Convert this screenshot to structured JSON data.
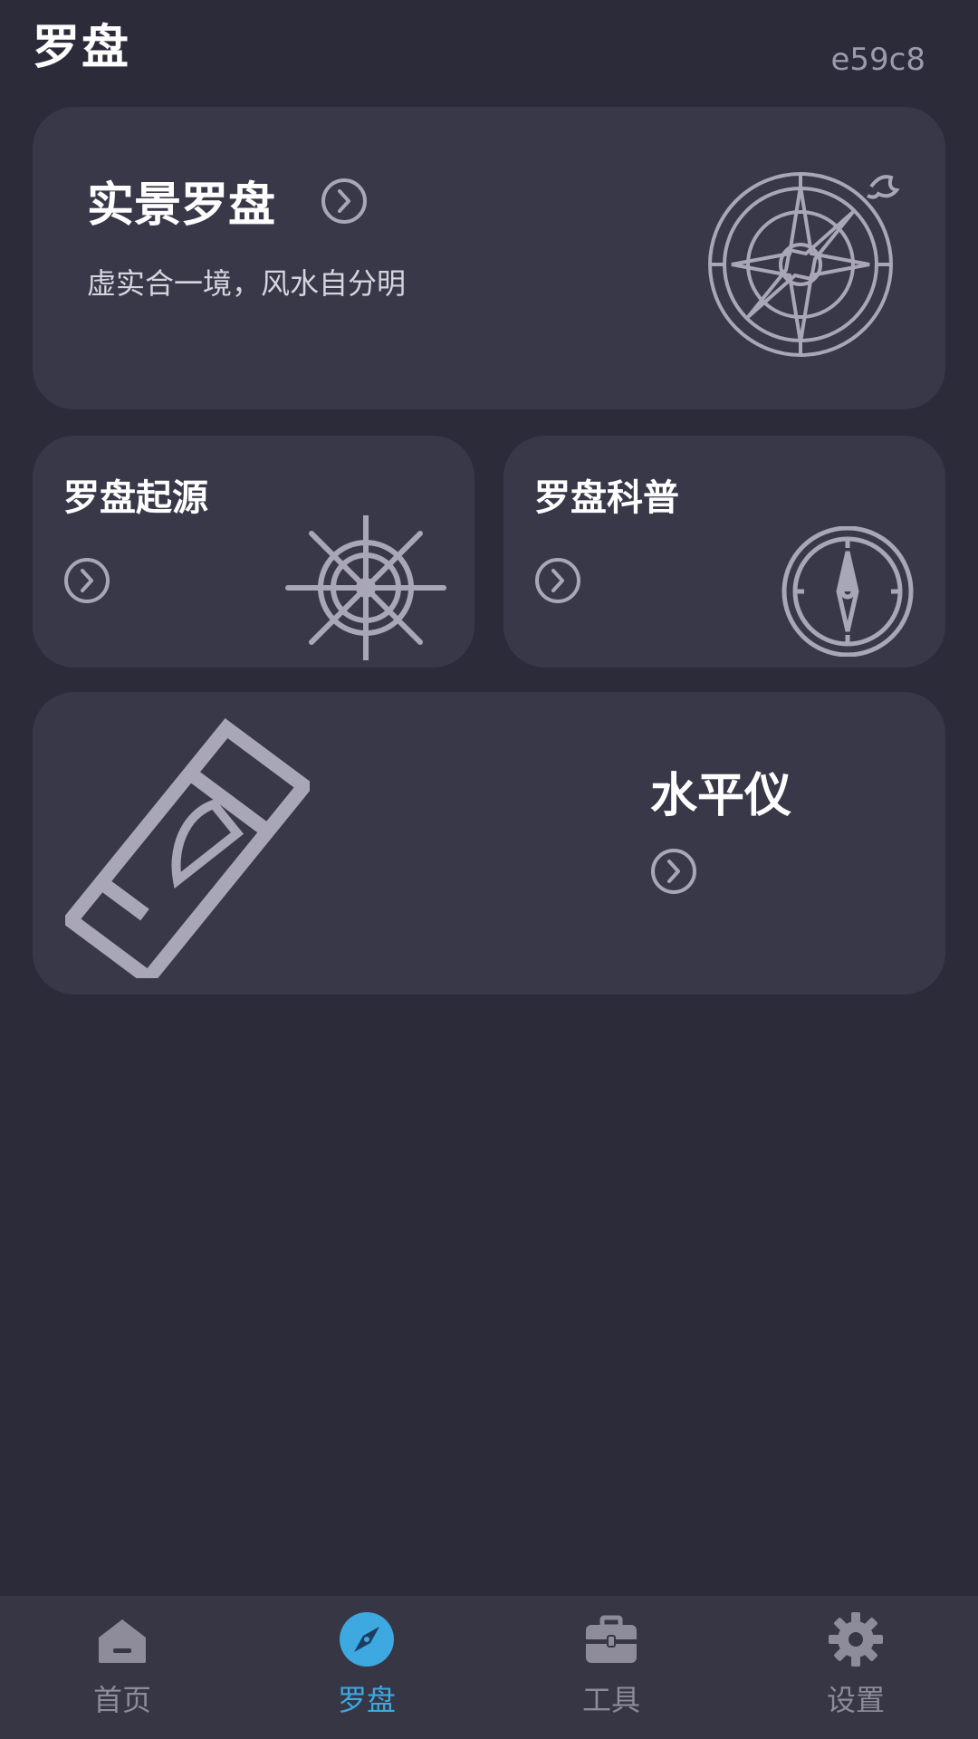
{
  "header": {
    "title": "罗盘",
    "code": "e59c8"
  },
  "cards": {
    "ar": {
      "title": "实景罗盘",
      "subtitle": "虚实合一境，风水自分明"
    },
    "origin": {
      "title": "罗盘起源"
    },
    "science": {
      "title": "罗盘科普"
    },
    "level": {
      "title": "水平仪"
    }
  },
  "nav": {
    "items": [
      {
        "label": "首页"
      },
      {
        "label": "罗盘"
      },
      {
        "label": "工具"
      },
      {
        "label": "设置"
      }
    ],
    "active_color": "#3ea8e0",
    "inactive_color": "#8e8c9a"
  },
  "colors": {
    "background": "#2c2b3a",
    "card": "#393849",
    "icon_stroke": "#a9a6b8"
  }
}
